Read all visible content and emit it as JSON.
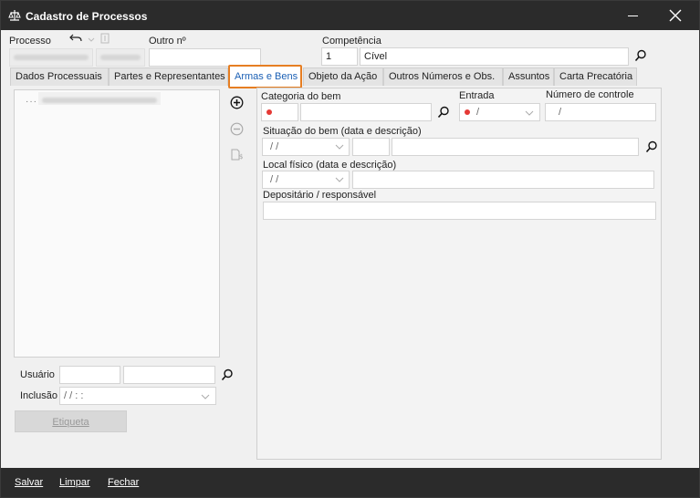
{
  "window": {
    "title": "Cadastro de Processos"
  },
  "header": {
    "processo_label": "Processo",
    "outro_label": "Outro nº",
    "competencia_label": "Competência",
    "competencia_code": "1",
    "competencia_value": "Cível"
  },
  "tabs": [
    {
      "label": "Dados Processuais"
    },
    {
      "label": "Partes e Representantes"
    },
    {
      "label": "Armas e Bens"
    },
    {
      "label": "Objeto da Ação"
    },
    {
      "label": "Outros Números e Obs."
    },
    {
      "label": "Assuntos"
    },
    {
      "label": "Carta Precatória"
    }
  ],
  "left": {
    "tree_prefix": "·····",
    "usuario_label": "Usuário",
    "inclusao_label": "Inclusão",
    "inclusao_value": "/ /      : :",
    "etiqueta_label": "Etiqueta"
  },
  "form": {
    "categoria_label": "Categoria do bem",
    "entrada_label": "Entrada",
    "entrada_value": "/",
    "numero_label": "Número de controle",
    "numero_value": "/",
    "situacao_label": "Situação do bem (data e descrição)",
    "situacao_date": "/ /",
    "local_label": "Local físico (data e descrição)",
    "local_date": "/ /",
    "depositario_label": "Depositário / responsável"
  },
  "footer": {
    "salvar": "Salvar",
    "limpar": "Limpar",
    "fechar": "Fechar"
  },
  "colors": {
    "titlebar": "#2b2b2b",
    "active_tab_border": "#e67e22",
    "active_tab_text": "#1a5fb4",
    "required_dot": "#e53935"
  }
}
